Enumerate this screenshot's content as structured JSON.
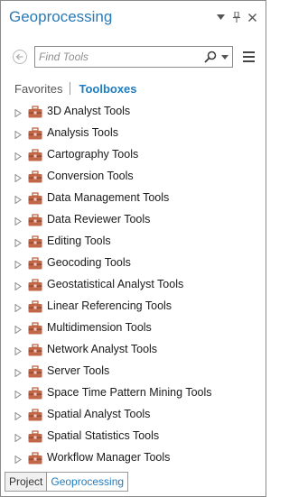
{
  "pane": {
    "title": "Geoprocessing"
  },
  "search": {
    "placeholder": "Find Tools",
    "value": ""
  },
  "view_tabs": {
    "favorites": "Favorites",
    "toolboxes": "Toolboxes",
    "active": "Toolboxes"
  },
  "toolboxes": [
    {
      "label": "3D Analyst Tools"
    },
    {
      "label": "Analysis Tools"
    },
    {
      "label": "Cartography Tools"
    },
    {
      "label": "Conversion Tools"
    },
    {
      "label": "Data Management Tools"
    },
    {
      "label": "Data Reviewer Tools"
    },
    {
      "label": "Editing Tools"
    },
    {
      "label": "Geocoding Tools"
    },
    {
      "label": "Geostatistical Analyst Tools"
    },
    {
      "label": "Linear Referencing Tools"
    },
    {
      "label": "Multidimension Tools"
    },
    {
      "label": "Network Analyst Tools"
    },
    {
      "label": "Server Tools"
    },
    {
      "label": "Space Time Pattern Mining Tools"
    },
    {
      "label": "Spatial Analyst Tools"
    },
    {
      "label": "Spatial Statistics Tools"
    },
    {
      "label": "Workflow Manager Tools"
    }
  ],
  "bottom_tabs": [
    {
      "label": "Project"
    },
    {
      "label": "Geoprocessing"
    }
  ],
  "icons": {
    "toolbox": "toolbox-icon",
    "expander": "expand-arrow-icon",
    "search": "search-icon",
    "back": "back-arrow-icon",
    "menu": "menu-icon",
    "pin": "pin-icon",
    "close": "close-icon",
    "dropdown": "chevron-down-icon"
  },
  "colors": {
    "accent": "#1f7cc0",
    "title": "#2a7ab6",
    "toolbox_icon": "#c0674a"
  }
}
